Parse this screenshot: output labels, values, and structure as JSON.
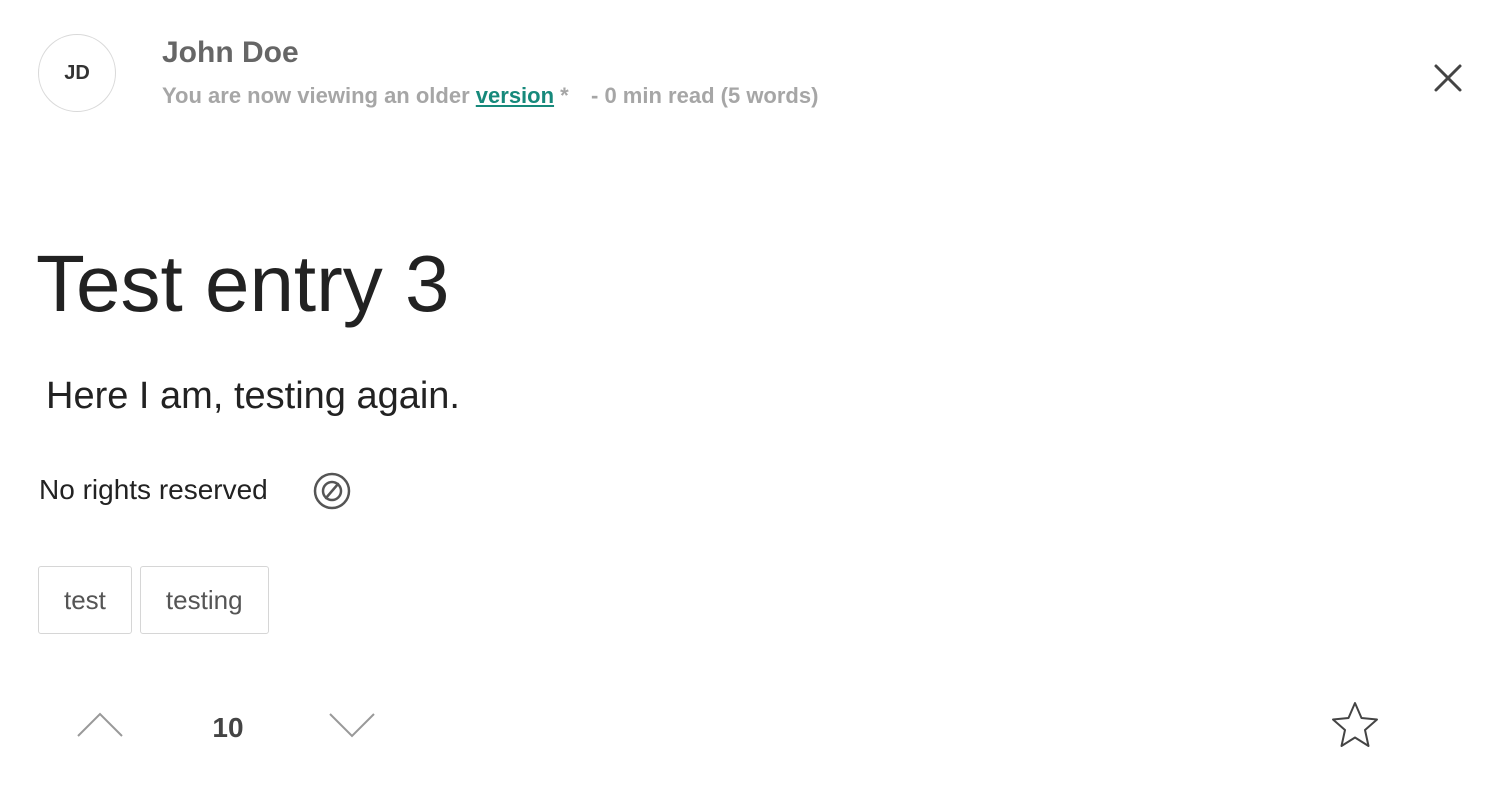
{
  "header": {
    "avatar_initials": "JD",
    "author_name": "John Doe",
    "version_notice": "You are now viewing an older",
    "version_link": "version",
    "version_marker": "*",
    "separator": "-",
    "read_time": "0 min",
    "read_label": "read",
    "word_count": "(5 words)"
  },
  "entry": {
    "title": "Test entry 3",
    "body": "Here I am, testing again.",
    "license": "No rights reserved"
  },
  "tags": [
    "test",
    "testing"
  ],
  "votes": {
    "count": "10"
  },
  "icons": {
    "close": "close-icon",
    "license": "no-copyright-icon",
    "upvote": "chevron-up-icon",
    "downvote": "chevron-down-icon",
    "favorite": "star-icon"
  },
  "colors": {
    "link": "#16897b",
    "muted": "#a6a6a6",
    "text": "#222222"
  }
}
